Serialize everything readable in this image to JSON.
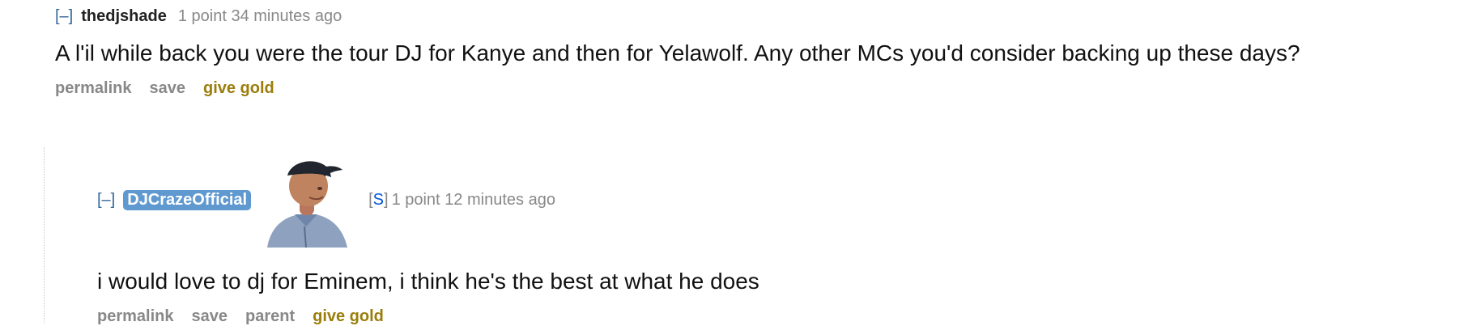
{
  "top_comment": {
    "expand_label": "[–]",
    "author": "thedjshade",
    "score": "1 point",
    "time": "34 minutes ago",
    "body": "A l'il while back you were the tour DJ for Kanye and then for Yelawolf. Any other MCs you'd consider backing up these days?",
    "buttons": {
      "permalink": "permalink",
      "save": "save",
      "give_gold": "give gold"
    }
  },
  "reply": {
    "expand_label": "[–]",
    "author": "DJCrazeOfficial",
    "avatar_icon": "user-photo-icon",
    "submitter_open": "[",
    "submitter_letter": "S",
    "submitter_close": "]",
    "score": "1 point",
    "time": "12 minutes ago",
    "body": "i would love to dj for Eminem, i think he's the best at what he does",
    "buttons": {
      "permalink": "permalink",
      "save": "save",
      "parent": "parent",
      "give_gold": "give gold"
    }
  },
  "colors": {
    "link_blue": "#336699",
    "flair_blue": "#5f99cf",
    "gold": "#9a7d0a",
    "meta_gray": "#888888"
  }
}
